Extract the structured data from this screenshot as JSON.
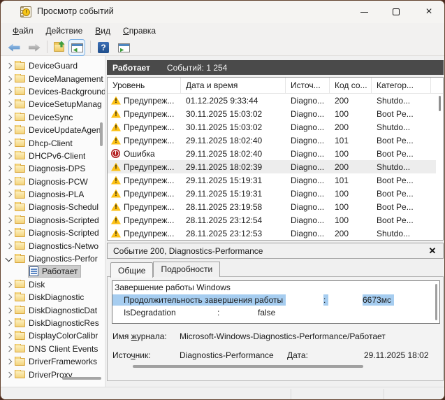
{
  "colors": {
    "header_bar": "#4a4a4a",
    "selection_highlight": "#a6cdf0",
    "warning_yellow": "#fdc116",
    "error_red": "#b21d1e",
    "tree_selected_bg": "#cccccc",
    "window_frame": "#4b2b20"
  },
  "window": {
    "title": "Просмотр событий",
    "icon": "event-viewer-icon",
    "controls": [
      "minimize",
      "maximize",
      "close"
    ]
  },
  "menu": {
    "items": [
      {
        "u": "Ф",
        "rest": "айл"
      },
      {
        "u": "Д",
        "rest": "ействие"
      },
      {
        "u": "В",
        "rest": "ид"
      },
      {
        "u": "С",
        "rest": "правка"
      }
    ]
  },
  "toolbar": {
    "icons": [
      "back-arrow-icon",
      "forward-arrow-icon",
      "export-folder-icon",
      "show-console-tree-icon",
      "help-icon",
      "action-pane-icon"
    ]
  },
  "tree": {
    "items": [
      {
        "label": "DeviceGuard",
        "icon": "folder",
        "level": 0,
        "chevron": "collapsed",
        "selected": false
      },
      {
        "label": "DeviceManagement",
        "icon": "folder",
        "level": 0,
        "chevron": "collapsed",
        "selected": false
      },
      {
        "label": "Devices-Background",
        "icon": "folder",
        "level": 0,
        "chevron": "collapsed",
        "selected": false
      },
      {
        "label": "DeviceSetupManag",
        "icon": "folder",
        "level": 0,
        "chevron": "collapsed",
        "selected": false
      },
      {
        "label": "DeviceSync",
        "icon": "folder",
        "level": 0,
        "chevron": "collapsed",
        "selected": false
      },
      {
        "label": "DeviceUpdateAgen",
        "icon": "folder",
        "level": 0,
        "chevron": "collapsed",
        "selected": false
      },
      {
        "label": "Dhcp-Client",
        "icon": "folder",
        "level": 0,
        "chevron": "collapsed",
        "selected": false
      },
      {
        "label": "DHCPv6-Client",
        "icon": "folder",
        "level": 0,
        "chevron": "collapsed",
        "selected": false
      },
      {
        "label": "Diagnosis-DPS",
        "icon": "folder",
        "level": 0,
        "chevron": "collapsed",
        "selected": false
      },
      {
        "label": "Diagnosis-PCW",
        "icon": "folder",
        "level": 0,
        "chevron": "collapsed",
        "selected": false
      },
      {
        "label": "Diagnosis-PLA",
        "icon": "folder",
        "level": 0,
        "chevron": "collapsed",
        "selected": false
      },
      {
        "label": "Diagnosis-Schedul",
        "icon": "folder",
        "level": 0,
        "chevron": "collapsed",
        "selected": false
      },
      {
        "label": "Diagnosis-Scripted",
        "icon": "folder",
        "level": 0,
        "chevron": "collapsed",
        "selected": false
      },
      {
        "label": "Diagnosis-Scripted",
        "icon": "folder",
        "level": 0,
        "chevron": "collapsed",
        "selected": false
      },
      {
        "label": "Diagnostics-Netwo",
        "icon": "folder",
        "level": 0,
        "chevron": "collapsed",
        "selected": false
      },
      {
        "label": "Diagnostics-Perfor",
        "icon": "folder",
        "level": 0,
        "chevron": "expanded",
        "selected": false
      },
      {
        "label": "Работает",
        "icon": "log",
        "level": 1,
        "chevron": "none",
        "selected": true
      },
      {
        "label": "Disk",
        "icon": "folder",
        "level": 0,
        "chevron": "collapsed",
        "selected": false
      },
      {
        "label": "DiskDiagnostic",
        "icon": "folder",
        "level": 0,
        "chevron": "collapsed",
        "selected": false
      },
      {
        "label": "DiskDiagnosticDat",
        "icon": "folder",
        "level": 0,
        "chevron": "collapsed",
        "selected": false
      },
      {
        "label": "DiskDiagnosticRes",
        "icon": "folder",
        "level": 0,
        "chevron": "collapsed",
        "selected": false
      },
      {
        "label": "DisplayColorCalibr",
        "icon": "folder",
        "level": 0,
        "chevron": "collapsed",
        "selected": false
      },
      {
        "label": "DNS Client Events",
        "icon": "folder",
        "level": 0,
        "chevron": "collapsed",
        "selected": false
      },
      {
        "label": "DriverFrameworks",
        "icon": "folder",
        "level": 0,
        "chevron": "collapsed",
        "selected": false
      },
      {
        "label": "DriverProxy",
        "icon": "folder",
        "level": 0,
        "chevron": "collapsed",
        "selected": false
      }
    ]
  },
  "list": {
    "header_log": "Работает",
    "header_events": "Событий: 1 254",
    "columns": [
      "Уровень",
      "Дата и время",
      "Источ...",
      "Код со...",
      "Категор...",
      ""
    ],
    "rows": [
      {
        "icon": "warning",
        "level": "Предупреж...",
        "datetime": "01.12.2025 9:33:44",
        "source": "Diagno...",
        "code": "200",
        "category": "Shutdo...",
        "selected": false
      },
      {
        "icon": "warning",
        "level": "Предупреж...",
        "datetime": "30.11.2025 15:03:02",
        "source": "Diagno...",
        "code": "100",
        "category": "Boot Pe...",
        "selected": false
      },
      {
        "icon": "warning",
        "level": "Предупреж...",
        "datetime": "30.11.2025 15:03:02",
        "source": "Diagno...",
        "code": "200",
        "category": "Shutdo...",
        "selected": false
      },
      {
        "icon": "warning",
        "level": "Предупреж...",
        "datetime": "29.11.2025 18:02:40",
        "source": "Diagno...",
        "code": "101",
        "category": "Boot Pe...",
        "selected": false
      },
      {
        "icon": "error",
        "level": "Ошибка",
        "datetime": "29.11.2025 18:02:40",
        "source": "Diagno...",
        "code": "100",
        "category": "Boot Pe...",
        "selected": false
      },
      {
        "icon": "warning",
        "level": "Предупреж...",
        "datetime": "29.11.2025 18:02:39",
        "source": "Diagno...",
        "code": "200",
        "category": "Shutdo...",
        "selected": true
      },
      {
        "icon": "warning",
        "level": "Предупреж...",
        "datetime": "29.11.2025 15:19:31",
        "source": "Diagno...",
        "code": "101",
        "category": "Boot Pe...",
        "selected": false
      },
      {
        "icon": "warning",
        "level": "Предупреж...",
        "datetime": "29.11.2025 15:19:31",
        "source": "Diagno...",
        "code": "100",
        "category": "Boot Pe...",
        "selected": false
      },
      {
        "icon": "warning",
        "level": "Предупреж...",
        "datetime": "28.11.2025 23:19:58",
        "source": "Diagno...",
        "code": "100",
        "category": "Boot Pe...",
        "selected": false
      },
      {
        "icon": "warning",
        "level": "Предупреж...",
        "datetime": "28.11.2025 23:12:54",
        "source": "Diagno...",
        "code": "100",
        "category": "Boot Pe...",
        "selected": false
      },
      {
        "icon": "warning",
        "level": "Предупреж...",
        "datetime": "28.11.2025 23:12:53",
        "source": "Diagno...",
        "code": "200",
        "category": "Shutdo...",
        "selected": false
      }
    ]
  },
  "preview": {
    "title": "Событие 200, Diagnostics-Performance",
    "tabs": [
      {
        "label": "Общие",
        "active": true
      },
      {
        "label": "Подробности",
        "active": false
      }
    ],
    "general": {
      "line1": "Завершение работы Windows",
      "duration_label": "Продолжительность завершения работы",
      "colon": ":",
      "duration_value": "6673мс",
      "degradation_label": "IsDegradation",
      "degradation_value": "false"
    },
    "fields": {
      "log_name": {
        "pre": "Имя ",
        "u": "ж",
        "post": "урнала:"
      },
      "log_name_value": "Microsoft-Windows-Diagnostics-Performance/Работает",
      "source": {
        "pre": "Исто",
        "u": "ч",
        "post": "ник:"
      },
      "source_value": "Diagnostics-Performance",
      "date": {
        "pre": "",
        "u": "Д",
        "post": "ата:"
      },
      "date_value": "29.11.2025 18:02"
    }
  }
}
